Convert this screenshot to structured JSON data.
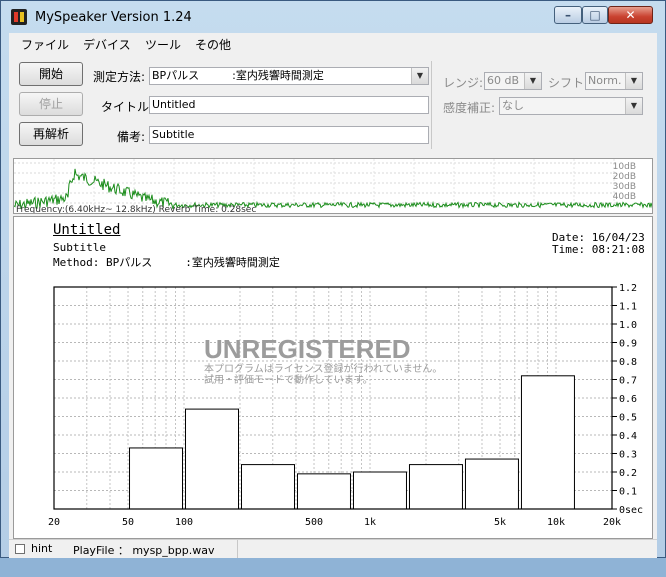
{
  "window": {
    "title": "MySpeaker Version 1.24"
  },
  "menubar": [
    "ファイル",
    "デバイス",
    "ツール",
    "その他"
  ],
  "buttons": {
    "start": "開始",
    "stop": "停止",
    "reanalyze": "再解析"
  },
  "form": {
    "method_label": "測定方法:",
    "method_value": "BPパルス　　　:室内残響時間測定",
    "title_label": "タイトル:",
    "title_value": "Untitled",
    "note_label": "備考:",
    "note_value": "Subtitle"
  },
  "range": {
    "range_label": "レンジ:",
    "range_value": "60 dB",
    "shift_label": "シフト:",
    "shift_value": "Norm.",
    "correction_label": "感度補正:",
    "correction_value": "なし"
  },
  "spectrum": {
    "db_labels": [
      "10dB",
      "20dB",
      "30dB",
      "40dB"
    ],
    "info_text": "Frequency:(6.40kHz~ 12.8kHz)  Reverb Time: 0.28sec",
    "trace_color": "#1a8c1a"
  },
  "report": {
    "title": "Untitled",
    "subtitle": "Subtitle",
    "method": "Method:  BPパルス　　　:室内残響時間測定",
    "date": "Date: 16/04/23",
    "time": "Time: 08:21:08",
    "watermark": "UNREGISTERED",
    "watermark_note1": "本プログラムはライセンス登録が行われていません。",
    "watermark_note2": "試用・評価モードで動作しています。"
  },
  "chart_data": {
    "type": "bar",
    "x_scale": "log",
    "xlim": [
      20,
      20000
    ],
    "ylim": [
      0,
      1.2
    ],
    "x_ticks": [
      20,
      50,
      100,
      500,
      1000,
      5000,
      10000,
      20000
    ],
    "x_tick_labels": [
      "20",
      "50",
      "100",
      "500",
      "1k",
      "5k",
      "10k",
      "20k"
    ],
    "y_ticks": [
      0,
      0.1,
      0.2,
      0.3,
      0.4,
      0.5,
      0.6,
      0.7,
      0.8,
      0.9,
      1.0,
      1.1,
      1.2
    ],
    "y_tick_labels": [
      "0sec",
      "0.1",
      "0.2",
      "0.3",
      "0.4",
      "0.5",
      "0.6",
      "0.7",
      "0.8",
      "0.9",
      "1.0",
      "1.1",
      "1.2"
    ],
    "grid": true,
    "bars": [
      {
        "from": 50,
        "to": 100,
        "value": 0.33
      },
      {
        "from": 100,
        "to": 200,
        "value": 0.54
      },
      {
        "from": 200,
        "to": 400,
        "value": 0.24
      },
      {
        "from": 400,
        "to": 800,
        "value": 0.19
      },
      {
        "from": 800,
        "to": 1600,
        "value": 0.2
      },
      {
        "from": 1600,
        "to": 3200,
        "value": 0.24
      },
      {
        "from": 3200,
        "to": 6400,
        "value": 0.27
      },
      {
        "from": 6400,
        "to": 12800,
        "value": 0.72
      }
    ]
  },
  "status": {
    "hint_label": "hint",
    "playfile": "PlayFile ： mysp_bpp.wav"
  }
}
